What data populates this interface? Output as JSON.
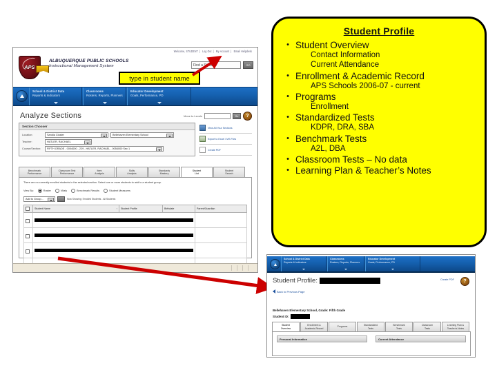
{
  "app_window": {
    "util_links": [
      "Welcome, STUDENT",
      "Log Out",
      "My Account",
      "Email Helpdesk"
    ],
    "brand": {
      "line1": "ALBUQUERQUE PUBLIC SCHOOLS",
      "line2": "Instructional Management System",
      "logo_text": "APS"
    },
    "search": {
      "placeholder": "Find a Student:",
      "value": "Find a Student:",
      "go_label": "GO"
    },
    "nav": [
      {
        "line1": "School & District Data",
        "line2": "Reports & Indicators"
      },
      {
        "line1": "Classrooms",
        "line2": "Rosters, Reports, Planners"
      },
      {
        "line1": "Educator Development",
        "line2": "Goals, Performance, PD"
      }
    ],
    "page_title": "Analyze Sections",
    "move_to": {
      "label": "Move to Levels",
      "value": "",
      "go_label": "Go"
    },
    "help_glyph": "?",
    "section_chooser": {
      "heading": "Section Chooser",
      "rows": [
        {
          "label": "Location:",
          "value1": "Sandia Cluster",
          "value2": "Bellehaven Elementary School"
        },
        {
          "label": "Teacher:",
          "value1": "HATLER, RACHAEL"
        },
        {
          "label": "Course/Section:",
          "value1": "FIFTH GRADE - 0004000 - 229 - HATLER, RACHAEL - 0054000 Sec 1"
        }
      ],
      "links": [
        {
          "label": "View All Your Sections",
          "icon": "chart-icon"
        },
        {
          "label": "Export to Excel / MS Files",
          "icon": "excel-icon"
        },
        {
          "label": "Create PDF",
          "icon": "pdf-icon"
        }
      ]
    },
    "tabs": [
      {
        "line1": "Benchmark",
        "line2": "Performance",
        "active": false
      },
      {
        "line1": "Classroom Test",
        "line2": "Performance",
        "active": false
      },
      {
        "line1": "Item",
        "line2": "Analysis",
        "active": false
      },
      {
        "line1": "Skills",
        "line2": "Analysis",
        "active": false
      },
      {
        "line1": "Standards",
        "line2": "Mastery",
        "active": false
      },
      {
        "line1": "Student",
        "line2": "List",
        "active": true
      },
      {
        "line1": "Student",
        "line2": "Search",
        "active": false
      }
    ],
    "panel": {
      "note": "There are no currently enrolled students in the selected section. Select one or more students to add to a student group.",
      "view_by_label": "View By:",
      "view_by_options": [
        {
          "label": "Roster",
          "selected": true
        },
        {
          "label": "Vitals",
          "selected": false
        },
        {
          "label": "Benchmark Results",
          "selected": false
        },
        {
          "label": "Student Measures",
          "selected": false
        }
      ],
      "action_select": "Add to Group...",
      "action_go": "Go",
      "showing_text": "Now Showing: Enrolled Students - All Students"
    },
    "table": {
      "columns": [
        "",
        "Student Name",
        "Student Profile",
        "Birthdate",
        "Parent/Guardian"
      ],
      "sort_indicator": "↑",
      "rows": [
        {
          "redacted": true
        },
        {
          "redacted": true
        },
        {
          "redacted": true
        },
        {
          "redacted": true
        },
        {
          "redacted": true
        }
      ]
    }
  },
  "callout_type": {
    "text": "type in student name"
  },
  "profile_callout": {
    "title": "Student Profile",
    "items": [
      {
        "level": 1,
        "text": "Student Overview"
      },
      {
        "level": 2,
        "text": "Contact Information"
      },
      {
        "level": 2,
        "text": "Current Attendance"
      },
      {
        "level": 1,
        "text": "Enrollment & Academic Record"
      },
      {
        "level": 2,
        "text": "APS Schools 2006-07 - current"
      },
      {
        "level": 1,
        "text": "Programs"
      },
      {
        "level": 2,
        "text": "Enrollment"
      },
      {
        "level": 1,
        "text": "Standardized Tests"
      },
      {
        "level": 2,
        "text": "KDPR, DRA, SBA"
      },
      {
        "level": 1,
        "text": "Benchmark Tests"
      },
      {
        "level": 2,
        "text": "A2L, DBA"
      },
      {
        "level": 1,
        "text": "Classroom Tests – No data"
      },
      {
        "level": 1,
        "text": "Learning Plan & Teacher’s Notes"
      }
    ],
    "bullet": "•"
  },
  "profile_window": {
    "nav": [
      {
        "line1": "School & District Data",
        "line2": "Reports & Indicators"
      },
      {
        "line1": "Classrooms",
        "line2": "Rosters, Reports, Planners"
      },
      {
        "line1": "Educator Development",
        "line2": "Goals, Performance, PD"
      }
    ],
    "title": "Student Profile:",
    "create_pdf": "Create PDF",
    "help_glyph": "?",
    "back_link": "Back to Previous Page",
    "school_line": "Bellehaven Elementary School, Grade: Fifth Grade",
    "student_id_label": "Student ID:",
    "tabs": [
      {
        "line1": "Student",
        "line2": "Overview",
        "active": true
      },
      {
        "line1": "Enrollment &",
        "line2": "Academic Record",
        "active": false
      },
      {
        "line1": "Programs",
        "line2": "",
        "active": false
      },
      {
        "line1": "Standardized",
        "line2": "Tests",
        "active": false
      },
      {
        "line1": "Benchmark",
        "line2": "Tests",
        "active": false
      },
      {
        "line1": "Classroom",
        "line2": "Tests",
        "active": false
      },
      {
        "line1": "Learning Plan &",
        "line2": "Teacher's Notes",
        "active": false
      }
    ],
    "panes": [
      {
        "heading": "Personal Information"
      },
      {
        "heading": "Current Attendance"
      }
    ]
  },
  "colors": {
    "callout_yellow": "#ffff00",
    "arrow_red": "#cc0000",
    "nav_blue": "#1560ae",
    "aps_maroon": "#7a1119"
  }
}
